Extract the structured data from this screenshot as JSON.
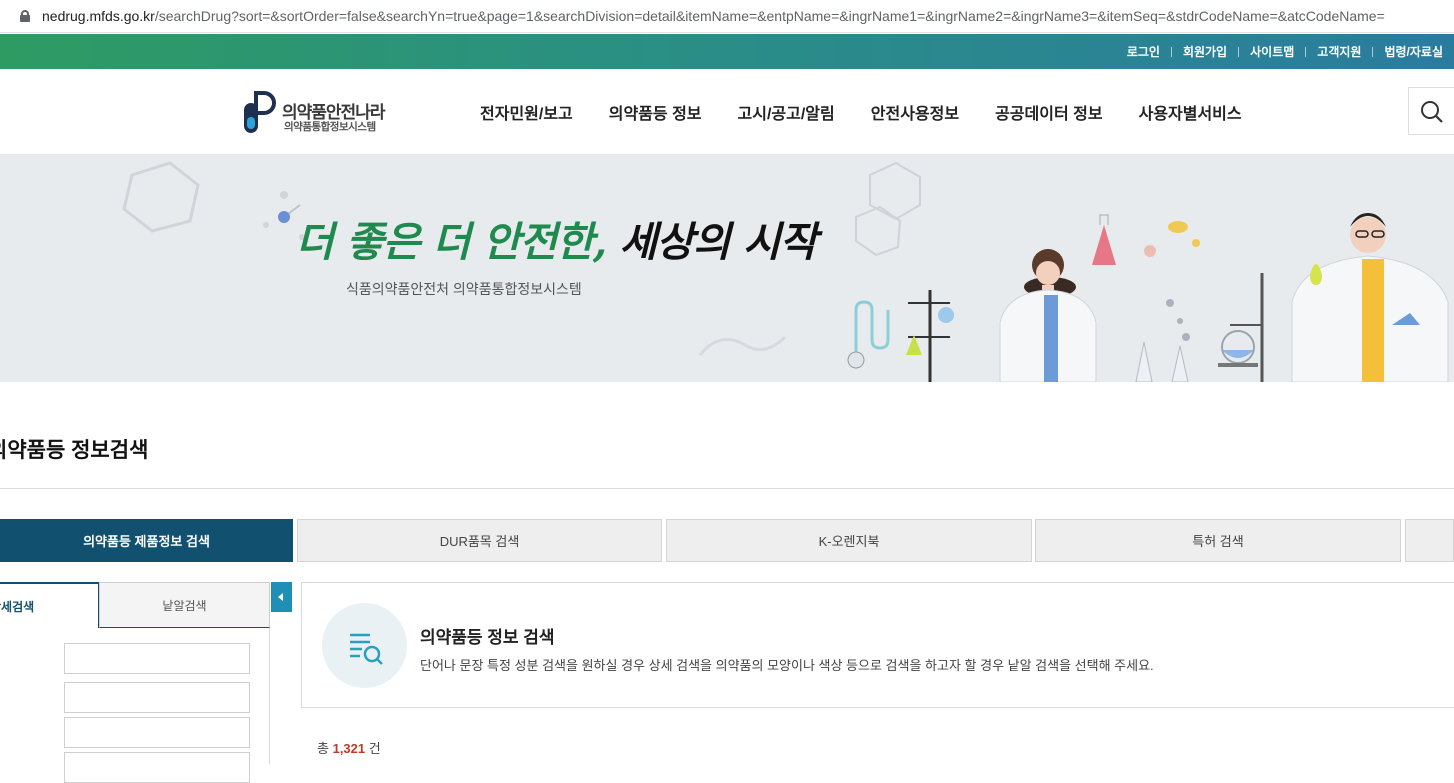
{
  "browser": {
    "url_host": "nedrug.mfds.go.kr",
    "url_path": "/searchDrug?sort=&sortOrder=false&searchYn=true&page=1&searchDivision=detail&itemName=&entpName=&ingrName1=&ingrName2=&ingrName3=&itemSeq=&stdrCodeName=&atcCodeName="
  },
  "utility_nav": [
    "로그인",
    "회원가입",
    "사이트맵",
    "고객지원",
    "법령/자료실"
  ],
  "logo": {
    "title": "의약품안전나라",
    "subtitle": "의약품통합정보시스템"
  },
  "gnb": [
    "전자민원/보고",
    "의약품등 정보",
    "고시/공고/알림",
    "안전사용정보",
    "공공데이터 정보",
    "사용자별서비스"
  ],
  "banner": {
    "slogan_green": "더 좋은 더 안전한,",
    "slogan_black": " 세상의 시작",
    "subtitle": "식품의약품안전처 의약품통합정보시스템"
  },
  "page_title": "의약품등 정보검색",
  "tabs": [
    "의약품등 제품정보 검색",
    "DUR품목 검색",
    "K-오렌지북",
    "특허 검색",
    ""
  ],
  "subtabs": {
    "detail": "상세검색",
    "pill": "낱알검색"
  },
  "info": {
    "title": "의약품등 정보 검색",
    "description": "단어나 문장 특정 성분 검색을 원하실 경우 상세 검색을 의약품의 모양이나 색상 등으로 검색을 하고자 할 경우 낱알 검색을 선택해 주세요."
  },
  "result": {
    "prefix": "총",
    "count": "1,321",
    "suffix": "건"
  },
  "colors": {
    "primary": "#11506e",
    "accent": "#1f8fb6",
    "count": "#c0392b"
  }
}
